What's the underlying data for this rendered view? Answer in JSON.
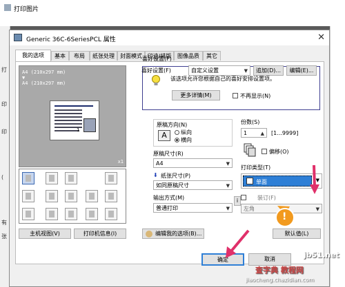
{
  "background": {
    "title": "打印图片",
    "side_labels": [
      "打",
      "印",
      "印",
      "(",
      "有",
      "张"
    ]
  },
  "dialog": {
    "title": "Generic 36C-6SeriesPCL 属性",
    "close": "✕"
  },
  "tabs": [
    "我的选项",
    "基本",
    "布局",
    "纸张处理",
    "封面模式",
    "印迹/排版",
    "图像品质",
    "其它"
  ],
  "preview": {
    "line1": "A4 (210x297 mm)",
    "arrow": "▼",
    "line2": "A4 (210x297 mm)",
    "page_num": "1",
    "copies_badge": "x1"
  },
  "left_buttons": {
    "host_view": "主机视图(V)",
    "printer_info": "打印机信息(I)"
  },
  "favorites": {
    "label": "喜好设置(F)",
    "value": "自定义设置",
    "add": "追加(D)...",
    "edit": "编辑(E)..."
  },
  "info": {
    "message": "该选项允许您根据自己的喜好安排设置项。",
    "more": "更多详情(M)",
    "no_show": "不再显示(N)"
  },
  "orientation": {
    "label": "原稿方向(N)",
    "portrait": "纵向",
    "landscape": "横向",
    "icon_letter": "A"
  },
  "original_size": {
    "label": "原稿尺寸(R)",
    "value": "A4"
  },
  "paper_size": {
    "label": "纸张尺寸(P)",
    "value": "如同原稿尺寸"
  },
  "output": {
    "label": "输出方式(M)",
    "value": "普通打印"
  },
  "copies": {
    "label": "份数(S)",
    "value": "1",
    "range": "[1...9999]"
  },
  "offset": {
    "label": "偏移(O)"
  },
  "print_type": {
    "label": "打印类型(T)",
    "value": "单面"
  },
  "binding": {
    "label": "装订(F)",
    "value": "左角"
  },
  "edit_options": "编辑我的选项(B)...",
  "defaults": "默认值(L)",
  "ok": "确定",
  "cancel": "取消",
  "callout": "!",
  "watermark": {
    "line1": "jb51.net",
    "line2": "查字典 教程网",
    "line3": "jiaocheng.chazidian.com"
  },
  "colors": {
    "highlight": "#2e7fd6",
    "accent": "#e0306a",
    "callout": "#f29a1e"
  }
}
